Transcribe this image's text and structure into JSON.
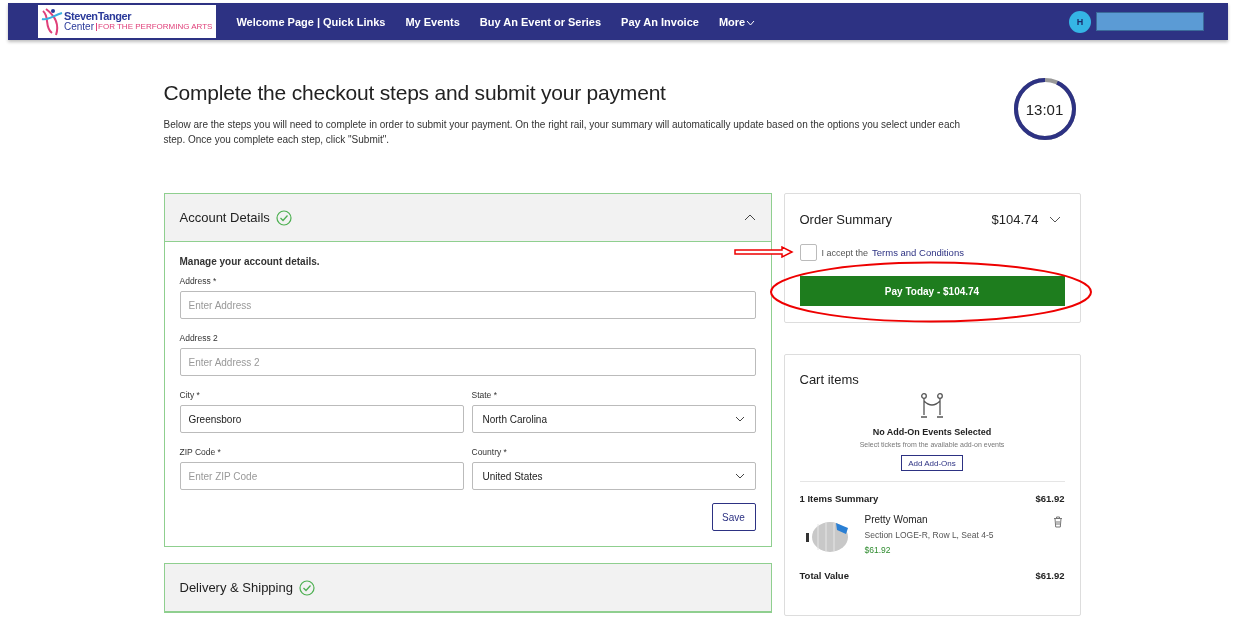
{
  "nav": {
    "logo": {
      "name": "StevenTanger",
      "sub": "Center",
      "tag": "FOR THE PERFORMING ARTS"
    },
    "links": [
      {
        "label": "Welcome Page | Quick Links",
        "dropdown": false
      },
      {
        "label": "My Events",
        "dropdown": false
      },
      {
        "label": "Buy An Event or Series",
        "dropdown": false
      },
      {
        "label": "Pay An Invoice",
        "dropdown": false
      },
      {
        "label": "More",
        "dropdown": true
      }
    ],
    "user": {
      "initial": "H"
    }
  },
  "header": {
    "title": "Complete the checkout steps and submit your payment",
    "description": "Below are the steps you will need to complete in order to submit your payment. On the right rail, your summary will automatically update based on the options you select under each step. Once you complete each step, click \"Submit\".",
    "timer": {
      "time": "13:01",
      "level": 0.93
    }
  },
  "steps": [
    {
      "title": "Account Details",
      "completed": true,
      "expanded": true,
      "intro": "Manage your account details.",
      "rows": [
        [
          {
            "label": "Address *",
            "kind": "text",
            "placeholder": "Enter Address"
          }
        ],
        [
          {
            "label": "Address 2",
            "kind": "text",
            "placeholder": "Enter Address 2"
          }
        ],
        [
          {
            "label": "City *",
            "kind": "text",
            "value": "Greensboro"
          },
          {
            "label": "State *",
            "kind": "select",
            "value": "North Carolina"
          }
        ],
        [
          {
            "label": "ZIP Code *",
            "kind": "text",
            "placeholder": "Enter ZIP Code"
          },
          {
            "label": "Country *",
            "kind": "select",
            "value": "United States"
          }
        ]
      ],
      "button": "Save"
    },
    {
      "title": "Delivery & Shipping",
      "completed": true,
      "expanded": false
    }
  ],
  "order_summary": {
    "title": "Order Summary",
    "total": "$104.74",
    "expanded": false,
    "terms": {
      "checked": false,
      "text": "I accept the",
      "link": "Terms and Conditions"
    },
    "pay_button": "Pay Today - $104.74"
  },
  "cart": {
    "title": "Cart items",
    "addons": {
      "title": "No Add-On Events Selected",
      "subtitle": "Select tickets from the available add-on events",
      "button": "Add Add-Ons"
    },
    "summary_label": "1 Items Summary",
    "summary_amount": "$61.92",
    "items": [
      {
        "name": "Pretty Woman",
        "seats": "Section LOGE-R, Row L, Seat 4-5",
        "price": "$61.92"
      }
    ],
    "total_label": "Total Value",
    "total_amount": "$61.92"
  }
}
